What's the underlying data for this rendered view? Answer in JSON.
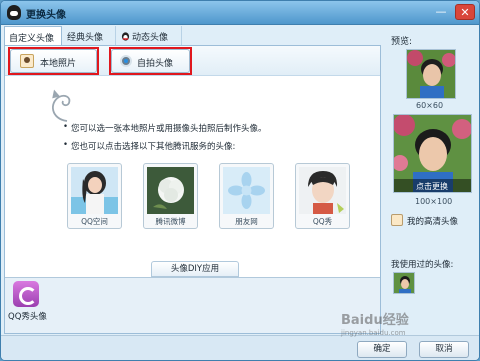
{
  "window": {
    "title": "更换头像"
  },
  "tabs": [
    {
      "label": "自定义头像",
      "active": true
    },
    {
      "label": "经典头像",
      "active": false
    },
    {
      "label": "动态头像",
      "active": false
    }
  ],
  "toolbar": {
    "local_photo_label": "本地照片",
    "selfie_label": "自拍头像"
  },
  "tips": {
    "line1": "您可以选一张本地照片或用摄像头拍照后制作头像。",
    "line2": "您也可以点击选择以下其他腾讯服务的头像:"
  },
  "services": [
    {
      "label": "QQ空间"
    },
    {
      "label": "腾讯微博"
    },
    {
      "label": "朋友网"
    },
    {
      "label": "QQ秀"
    }
  ],
  "diy": {
    "tab_label": "头像DIY应用",
    "app_label": "QQ秀头像"
  },
  "sidebar": {
    "preview_label": "预览:",
    "size_small": "60×60",
    "size_large": "100×100",
    "change_overlay": "点击更换",
    "hd_label": "我的高清头像",
    "used_label": "我使用过的头像:"
  },
  "buttons": {
    "ok": "确定",
    "cancel": "取消"
  },
  "watermark": {
    "text": "Baidu经验",
    "sub": "jingyan.baidu.com"
  },
  "colors": {
    "highlight": "#e0171d",
    "accent": "#4f97cc"
  }
}
